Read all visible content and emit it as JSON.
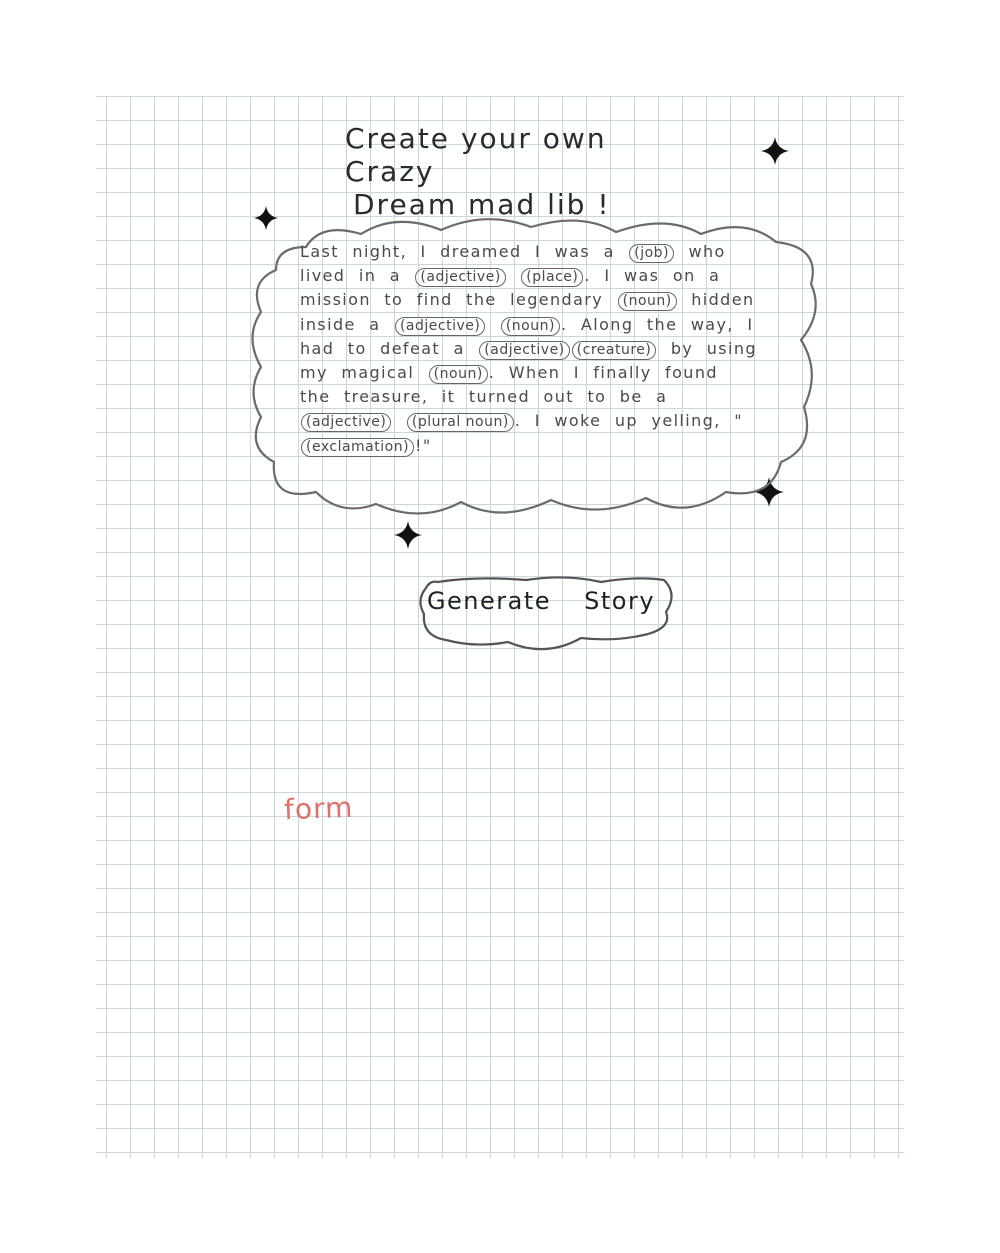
{
  "title": {
    "line1": "Create your own Crazy",
    "line2": "Dream mad lib !"
  },
  "story": {
    "parts": [
      {
        "t": "Last night, I dreamed I was a "
      },
      {
        "b": "(job)"
      },
      {
        "t": " who lived in a "
      },
      {
        "b": "(adjective)"
      },
      {
        "t": " "
      },
      {
        "b": "(place)"
      },
      {
        "t": ". I was on a mission to find the legendary "
      },
      {
        "b": "(noun)"
      },
      {
        "t": " hidden inside a "
      },
      {
        "b": "(adjective)"
      },
      {
        "t": " "
      },
      {
        "b": "(noun)"
      },
      {
        "t": ". Along the way, I had to defeat a "
      },
      {
        "b": "(adjective)"
      },
      {
        "b": "(creature)"
      },
      {
        "t": " by using my magical "
      },
      {
        "b": "(noun)"
      },
      {
        "t": ". When I finally found the treasure, it turned out to be a "
      },
      {
        "b": "(adjective)"
      },
      {
        "t": " "
      },
      {
        "b": "(plural noun)"
      },
      {
        "t": ". I woke up yelling, \""
      },
      {
        "b": "(exclamation)"
      },
      {
        "t": "!\""
      }
    ]
  },
  "button": {
    "label": "Generate Story"
  },
  "note": {
    "text": "form",
    "color": "#e0716a"
  },
  "icons": {
    "decoration": "sparkle-icon"
  },
  "colors": {
    "pencil": "#5a5a5a",
    "grid": "#c9d6e2"
  }
}
